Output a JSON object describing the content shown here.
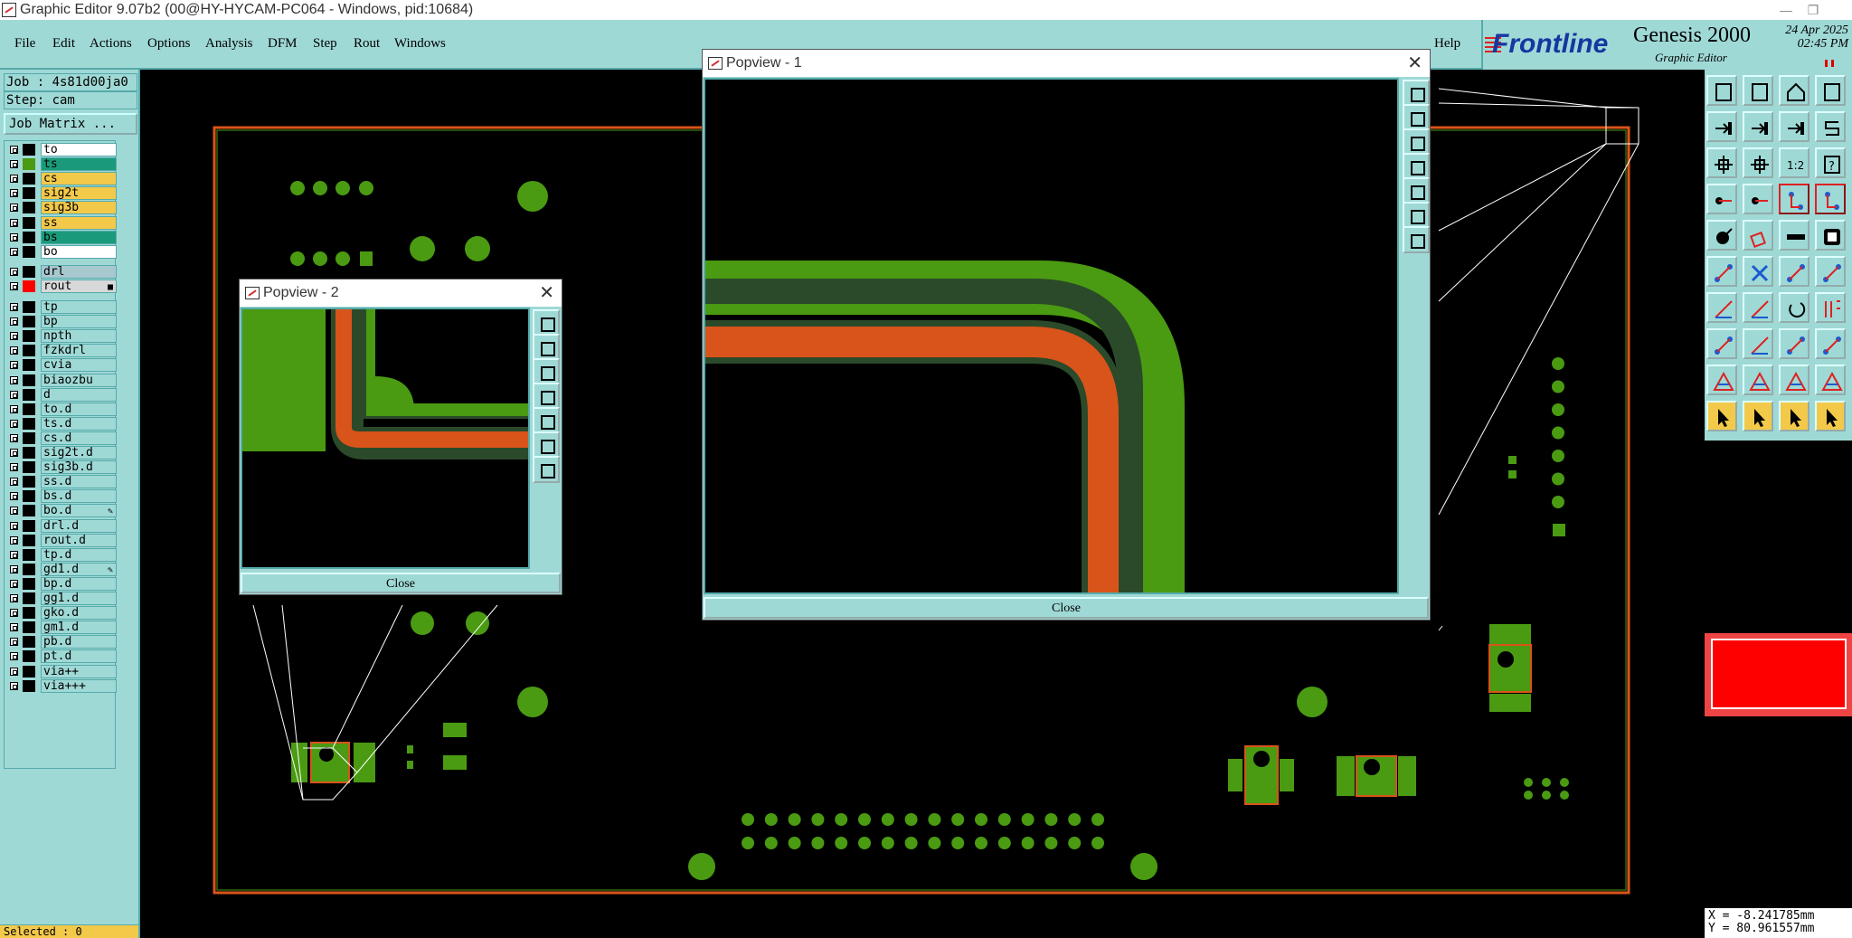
{
  "window": {
    "title": "Graphic Editor 9.07b2 (00@HY-HYCAM-PC064 - Windows, pid:10684)"
  },
  "menu": {
    "file": "File",
    "edit": "Edit",
    "actions": "Actions",
    "options": "Options",
    "analysis": "Analysis",
    "dfm": "DFM",
    "step": "Step",
    "rout": "Rout",
    "windows": "Windows",
    "help": "Help"
  },
  "brand": {
    "vendor": "Frontline",
    "product": "Genesis 2000",
    "subtitle": "Graphic Editor",
    "date": "24 Apr 2025",
    "time": "02:45 PM"
  },
  "job": {
    "job_label": "Job : 4s81d00ja0",
    "step_label": "Step: cam",
    "job_matrix": "Job Matrix ..."
  },
  "layers": [
    {
      "name": "to",
      "color": "#000000",
      "name_bg": "#ffffff"
    },
    {
      "name": "ts",
      "color": "#4a9a12",
      "name_bg": "#1a9a7a"
    },
    {
      "name": "cs",
      "color": "#000000",
      "name_bg": "#f3c94a"
    },
    {
      "name": "sig2t",
      "color": "#000000",
      "name_bg": "#f3c94a"
    },
    {
      "name": "sig3b",
      "color": "#000000",
      "name_bg": "#f3c94a"
    },
    {
      "name": "ss",
      "color": "#000000",
      "name_bg": "#f3c94a"
    },
    {
      "name": "bs",
      "color": "#000000",
      "name_bg": "#1a9a7a"
    },
    {
      "name": "bo",
      "color": "#000000",
      "name_bg": "#ffffff"
    },
    {
      "name": "drl",
      "color": "#000000",
      "name_bg": "#a8c8d0"
    },
    {
      "name": "rout",
      "color": "#ff0000",
      "name_bg": "#d8d8d8",
      "mark": "■"
    },
    {
      "name": "tp",
      "color": "#000000",
      "name_bg": "#9fd9d6"
    },
    {
      "name": "bp",
      "color": "#000000",
      "name_bg": "#9fd9d6"
    },
    {
      "name": "npth",
      "color": "#000000",
      "name_bg": "#9fd9d6"
    },
    {
      "name": "fzkdrl",
      "color": "#000000",
      "name_bg": "#9fd9d6"
    },
    {
      "name": "cvia",
      "color": "#000000",
      "name_bg": "#9fd9d6"
    },
    {
      "name": "biaozbu",
      "color": "#000000",
      "name_bg": "#9fd9d6"
    },
    {
      "name": "d",
      "color": "#000000",
      "name_bg": "#9fd9d6"
    },
    {
      "name": "to.d",
      "color": "#000000",
      "name_bg": "#9fd9d6"
    },
    {
      "name": "ts.d",
      "color": "#000000",
      "name_bg": "#9fd9d6"
    },
    {
      "name": "cs.d",
      "color": "#000000",
      "name_bg": "#9fd9d6"
    },
    {
      "name": "sig2t.d",
      "color": "#000000",
      "name_bg": "#9fd9d6"
    },
    {
      "name": "sig3b.d",
      "color": "#000000",
      "name_bg": "#9fd9d6"
    },
    {
      "name": "ss.d",
      "color": "#000000",
      "name_bg": "#9fd9d6"
    },
    {
      "name": "bs.d",
      "color": "#000000",
      "name_bg": "#9fd9d6"
    },
    {
      "name": "bo.d",
      "color": "#000000",
      "name_bg": "#9fd9d6",
      "mark": "✎"
    },
    {
      "name": "drl.d",
      "color": "#000000",
      "name_bg": "#9fd9d6"
    },
    {
      "name": "rout.d",
      "color": "#000000",
      "name_bg": "#9fd9d6"
    },
    {
      "name": "tp.d",
      "color": "#000000",
      "name_bg": "#9fd9d6"
    },
    {
      "name": "gd1.d",
      "color": "#000000",
      "name_bg": "#9fd9d6",
      "mark": "✎"
    },
    {
      "name": "bp.d",
      "color": "#000000",
      "name_bg": "#9fd9d6"
    },
    {
      "name": "gg1.d",
      "color": "#000000",
      "name_bg": "#9fd9d6"
    },
    {
      "name": "gko.d",
      "color": "#000000",
      "name_bg": "#9fd9d6"
    },
    {
      "name": "gm1.d",
      "color": "#000000",
      "name_bg": "#9fd9d6"
    },
    {
      "name": "pb.d",
      "color": "#000000",
      "name_bg": "#9fd9d6"
    },
    {
      "name": "pt.d",
      "color": "#000000",
      "name_bg": "#9fd9d6"
    },
    {
      "name": "via++",
      "color": "#000000",
      "name_bg": "#9fd9d6"
    },
    {
      "name": "via+++",
      "color": "#000000",
      "name_bg": "#9fd9d6"
    }
  ],
  "status": {
    "selected": "Selected : 0",
    "x": "X = -8.241785mm",
    "y": "Y = 80.961557mm"
  },
  "popview1": {
    "title": "Popview - 1",
    "close": "Close"
  },
  "popview2": {
    "title": "Popview - 2",
    "close": "Close"
  },
  "colors": {
    "panel": "#9fd9d6",
    "pad": "#4a9a12",
    "trace": "#d9541a",
    "active_color": "#ff0000"
  }
}
